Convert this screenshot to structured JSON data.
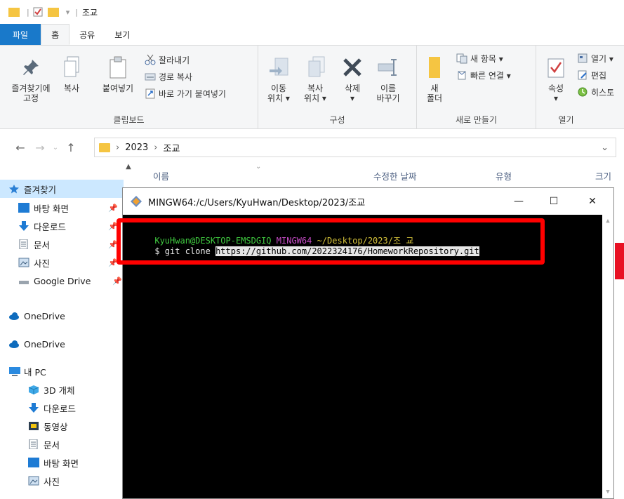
{
  "titlebar": {
    "path_sep": "|",
    "title": "조교"
  },
  "tabs": [
    {
      "label": "파일"
    },
    {
      "label": "홈"
    },
    {
      "label": "공유"
    },
    {
      "label": "보기"
    }
  ],
  "ribbon": {
    "clipboard": {
      "pin_label_1": "즐겨찾기에",
      "pin_label_2": "고정",
      "copy": "복사",
      "paste": "붙여넣기",
      "cut": "잘라내기",
      "copy_path": "경로 복사",
      "paste_shortcut": "바로 가기 붙여넣기",
      "group": "클립보드"
    },
    "organize": {
      "move_1": "이동",
      "move_2": "위치 ▾",
      "copyto_1": "복사",
      "copyto_2": "위치 ▾",
      "delete": "삭제",
      "delete_arrow": "▾",
      "rename_1": "이름",
      "rename_2": "바꾸기",
      "group": "구성"
    },
    "new": {
      "folder_1": "새",
      "folder_2": "폴더",
      "new_item": "새 항목 ▾",
      "easy_access": "빠른 연결 ▾",
      "group": "새로 만들기"
    },
    "open": {
      "properties": "속성",
      "properties_arrow": "▾",
      "open": "열기 ▾",
      "edit": "편집",
      "history": "히스토",
      "group": "열기"
    }
  },
  "address": {
    "crumbs": [
      "2023",
      "조교"
    ],
    "sep": "›",
    "dropdown": "⌄"
  },
  "columns": {
    "name": "이름",
    "date": "수정한 날짜",
    "type": "유형",
    "size": "크기"
  },
  "sidebar": {
    "items": [
      {
        "label": "즐겨찾기"
      },
      {
        "label": "바탕 화면"
      },
      {
        "label": "다운로드"
      },
      {
        "label": "문서"
      },
      {
        "label": "사진"
      },
      {
        "label": "Google Drive"
      },
      {
        "label": "OneDrive"
      },
      {
        "label": "OneDrive"
      },
      {
        "label": "내 PC"
      },
      {
        "label": "3D 개체"
      },
      {
        "label": "다운로드"
      },
      {
        "label": "동영상"
      },
      {
        "label": "문서"
      },
      {
        "label": "바탕 화면"
      },
      {
        "label": "사진"
      }
    ]
  },
  "terminal": {
    "title": "MINGW64:/c/Users/KyuHwan/Desktop/2023/조교",
    "user_host": "KyuHwan@DESKTOP-EMSDGIQ",
    "env": "MINGW64",
    "cwd": "~/Desktop/2023/조 교",
    "prompt": "$ git clone ",
    "url": "https://github.com/2022324176/HomeworkRepository.git",
    "minimize": "—",
    "maximize": "☐",
    "close": "✕"
  },
  "colors": {
    "file_tab": "#1979ca",
    "highlight": "#ff0000",
    "term_green": "#3fc93f",
    "term_magenta": "#c74cc7",
    "term_yellow": "#d5c33a",
    "selected_nav": "#cce8ff"
  },
  "icons": [
    "pin-icon",
    "copy-icon",
    "paste-icon",
    "cut-icon",
    "copy-path-icon",
    "paste-shortcut-icon",
    "move-to-icon",
    "copy-to-icon",
    "delete-icon",
    "rename-icon",
    "new-folder-icon",
    "new-item-icon",
    "easy-access-icon",
    "properties-icon",
    "open-icon",
    "edit-icon",
    "history-icon",
    "folder-icon",
    "mingw-icon"
  ]
}
